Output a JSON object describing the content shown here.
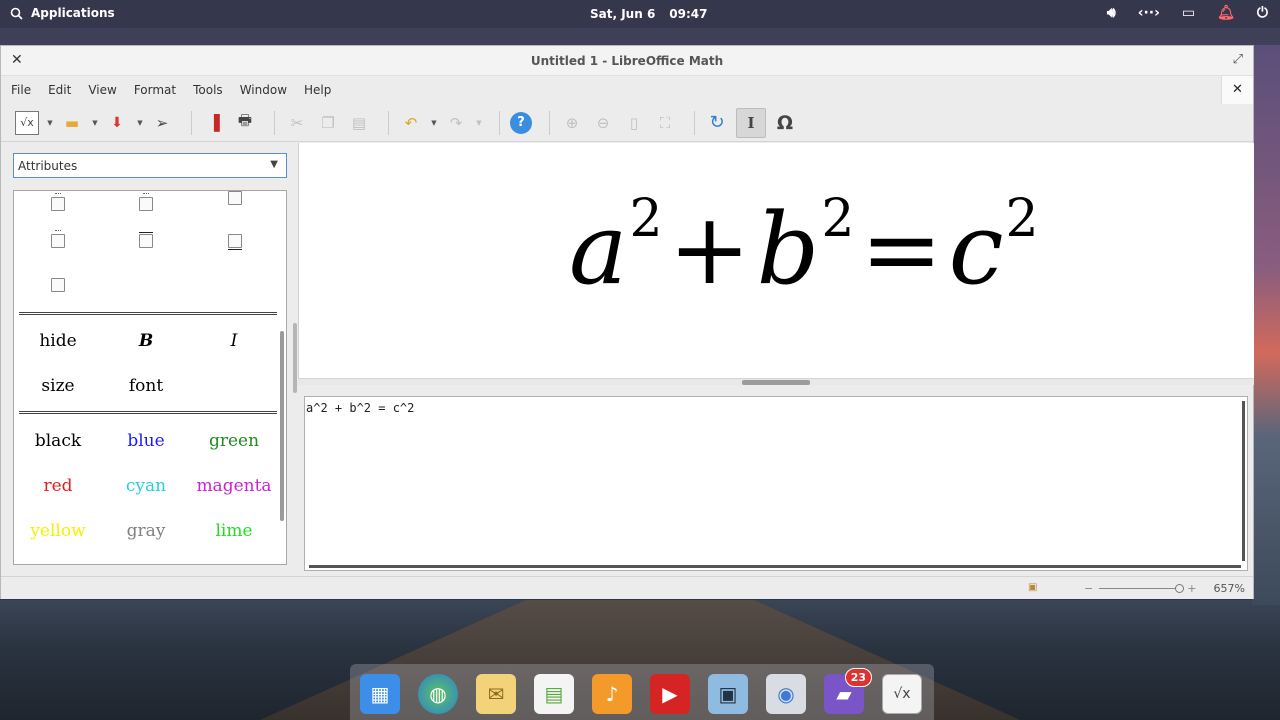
{
  "top_panel": {
    "applications": "Applications",
    "date": "Sat, Jun  6",
    "time": "09:47"
  },
  "window": {
    "title": "Untitled 1 - LibreOffice Math",
    "close_glyph": "✕",
    "maximize_glyph": "⤢"
  },
  "menu": [
    "File",
    "Edit",
    "View",
    "Format",
    "Tools",
    "Window",
    "Help"
  ],
  "doc_close_glyph": "✕",
  "sidebar": {
    "category": "Attributes",
    "attributes_words": [
      "hide",
      "B",
      "I",
      "size",
      "font"
    ],
    "colors": [
      {
        "label": "black",
        "color": "#000000"
      },
      {
        "label": "blue",
        "color": "#1a1aff"
      },
      {
        "label": "green",
        "color": "#1e8c1e"
      },
      {
        "label": "red",
        "color": "#e02020"
      },
      {
        "label": "cyan",
        "color": "#25d0e0"
      },
      {
        "label": "magenta",
        "color": "#d020d0"
      },
      {
        "label": "yellow",
        "color": "#f2f200"
      },
      {
        "label": "gray",
        "color": "#808080"
      },
      {
        "label": "lime",
        "color": "#22dd22"
      }
    ]
  },
  "formula": {
    "a": "a",
    "b": "b",
    "c": "c",
    "exp": "2",
    "plus": "+",
    "equals": "="
  },
  "editor": {
    "command": "a^2 + b^2 = c^2"
  },
  "status": {
    "zoom": "657%",
    "zoom_minus": "−",
    "zoom_plus": "+"
  },
  "dock": {
    "mail_badge": "23"
  }
}
